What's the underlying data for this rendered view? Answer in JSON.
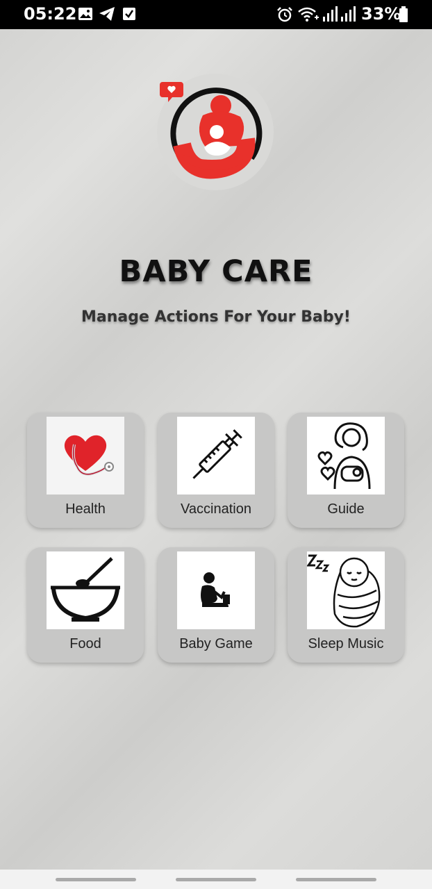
{
  "status_bar": {
    "time": "05:22",
    "battery": "33%",
    "left_icons": [
      "image-icon",
      "telegram-icon",
      "checkbox-icon"
    ],
    "right_icons": [
      "alarm-icon",
      "wifi-icon",
      "signal-icon",
      "signal-icon",
      "battery-icon"
    ]
  },
  "header": {
    "title": "BABY CARE",
    "subtitle": "Manage Actions For Your Baby!"
  },
  "menu": {
    "items": [
      {
        "label": "Health",
        "icon": "heart-stethoscope-icon"
      },
      {
        "label": "Vaccination",
        "icon": "syringe-icon"
      },
      {
        "label": "Guide",
        "icon": "mother-baby-icon"
      },
      {
        "label": "Food",
        "icon": "bowl-spoon-icon"
      },
      {
        "label": "Baby Game",
        "icon": "sitting-baby-icon"
      },
      {
        "label": "Sleep Music",
        "icon": "sleeping-baby-icon"
      }
    ]
  },
  "colors": {
    "brand_red": "#e8312b",
    "tile_bg": "#c7c7c6",
    "title": "#111111"
  }
}
